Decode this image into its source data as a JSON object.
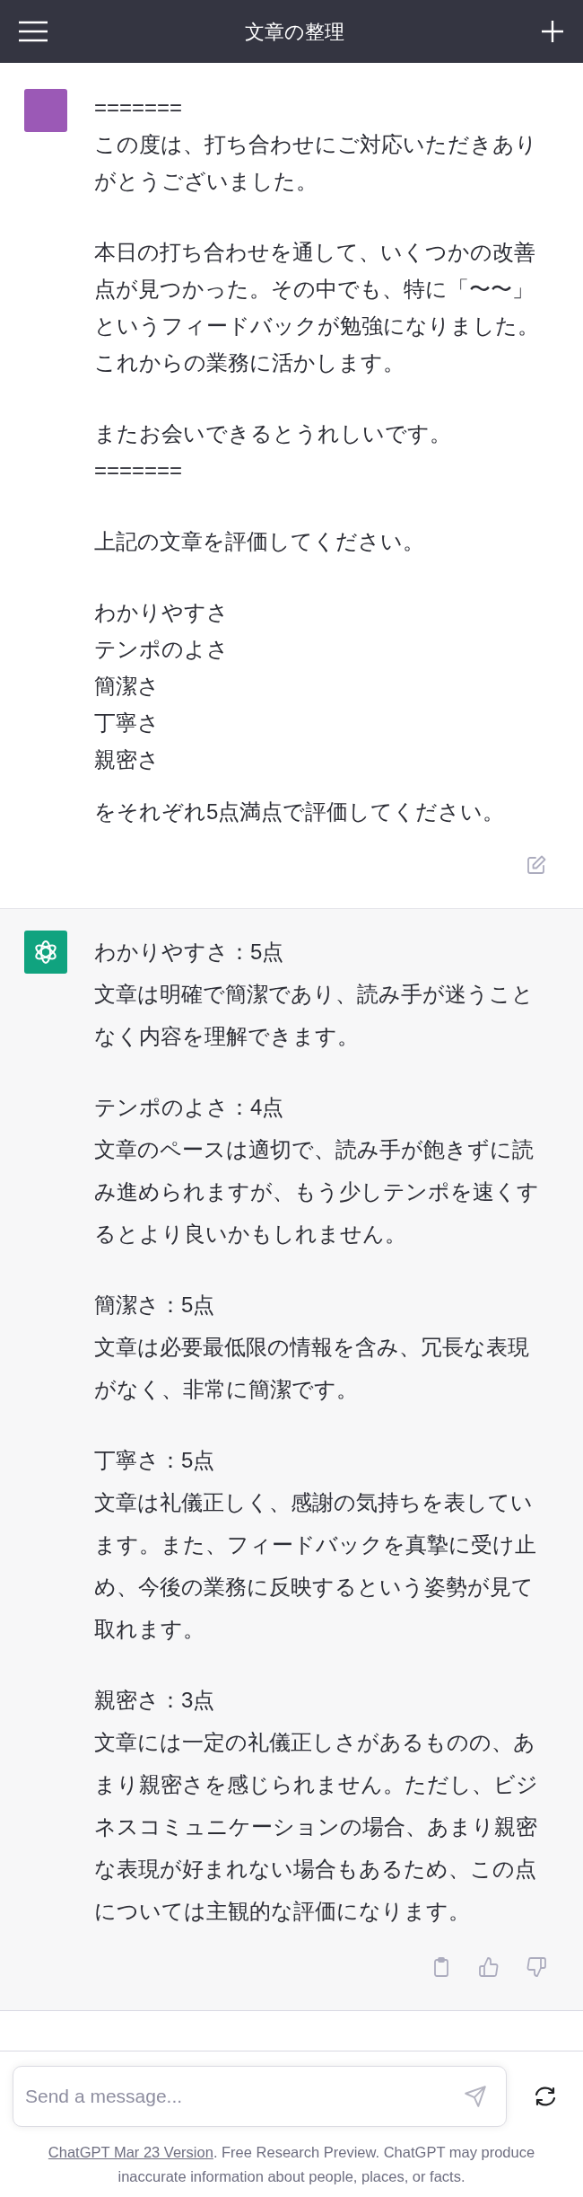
{
  "header": {
    "title": "文章の整理"
  },
  "messages": [
    {
      "kind": "user",
      "blocks": [
        {
          "kind": "text",
          "lines": [
            "=======",
            "この度は、打ち合わせにご対応いただきあり",
            "がとうございました。"
          ]
        },
        {
          "kind": "text",
          "lines": [
            "本日の打ち合わせを通して、いくつかの改善",
            "点が見つかった。その中でも、特に「〜〜」",
            "というフィードバックが勉強になりました。",
            "これからの業務に活かします。"
          ]
        },
        {
          "kind": "text",
          "lines": [
            "またお会いできるとうれしいです。",
            "======="
          ]
        },
        {
          "kind": "text",
          "lines": [
            "上記の文章を評価してください。"
          ]
        },
        {
          "kind": "list",
          "items": [
            "わかりやすさ",
            "テンポのよさ",
            "簡潔さ",
            "丁寧さ",
            "親密さ"
          ]
        },
        {
          "kind": "text",
          "lines": [
            "をそれぞれ5点満点で評価してください。"
          ]
        }
      ]
    },
    {
      "kind": "assistant",
      "blocks": [
        {
          "kind": "text",
          "lines": [
            "わかりやすさ：5点",
            "文章は明確で簡潔であり、読み手が迷うこと",
            "なく内容を理解できます。"
          ]
        },
        {
          "kind": "text",
          "lines": [
            "テンポのよさ：4点",
            "文章のペースは適切で、読み手が飽きずに読",
            "み進められますが、もう少しテンポを速くす",
            "るとより良いかもしれません。"
          ]
        },
        {
          "kind": "text",
          "lines": [
            "簡潔さ：5点",
            "文章は必要最低限の情報を含み、冗長な表現",
            "がなく、非常に簡潔です。"
          ]
        },
        {
          "kind": "text",
          "lines": [
            "丁寧さ：5点",
            "文章は礼儀正しく、感謝の気持ちを表してい",
            "ます。また、フィードバックを真摯に受け止",
            "め、今後の業務に反映するという姿勢が見て",
            "取れます。"
          ]
        },
        {
          "kind": "text",
          "lines": [
            "親密さ：3点",
            "文章には一定の礼儀正しさがあるものの、あ",
            "まり親密さを感じられません。ただし、ビジ",
            "ネスコミュニケーションの場合、あまり親密",
            "な表現が好まれない場合もあるため、この点",
            "については主観的な評価になります。"
          ]
        }
      ]
    }
  ],
  "composer": {
    "placeholder": "Send a message..."
  },
  "footer": {
    "link": "ChatGPT Mar 23 Version",
    "text": ". Free Research Preview. ChatGPT may produce inaccurate information about people, places, or facts."
  }
}
